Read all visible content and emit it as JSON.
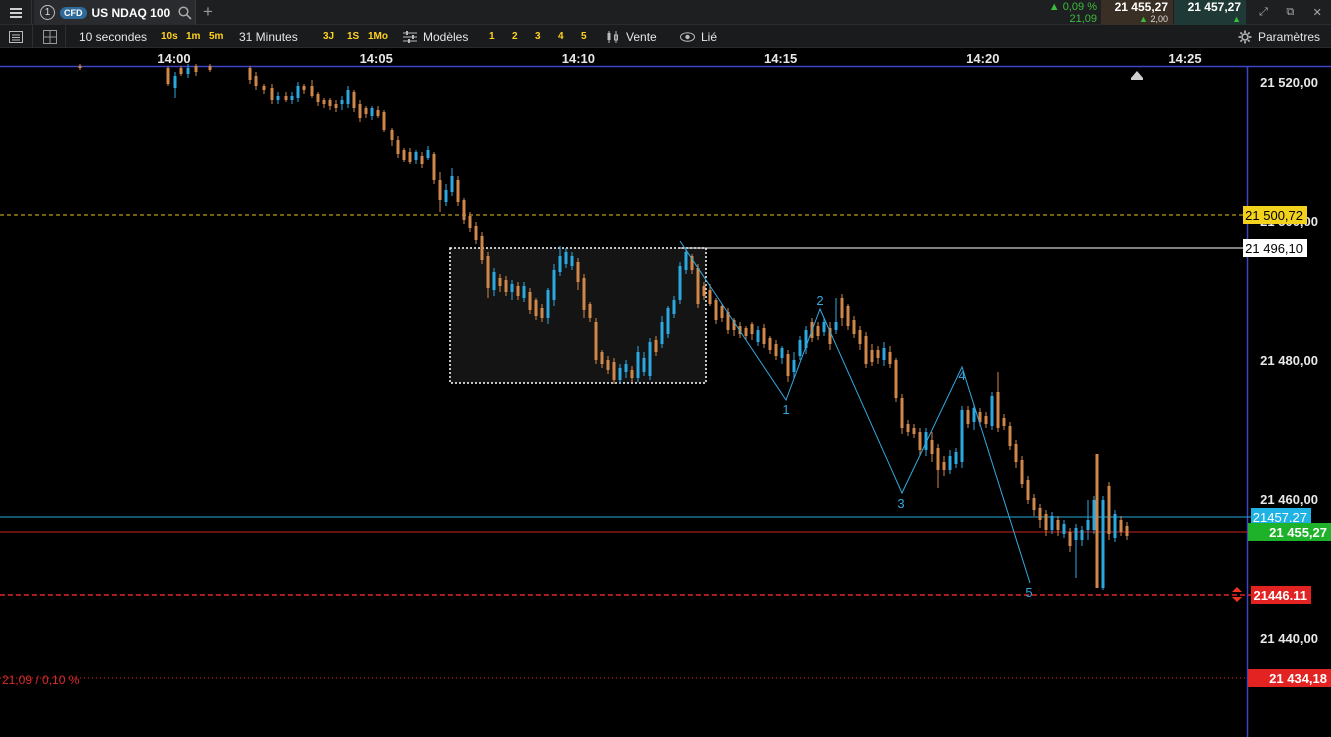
{
  "topbar": {
    "tab_number": "1",
    "cfd_badge": "CFD",
    "instrument": "US NDAQ 100",
    "change_pct": "▲ 0,09 %",
    "change_abs": "21,09",
    "sell_price": "21 455,27",
    "buy_price": "21 457,27",
    "spread": "2,00"
  },
  "toolbar": {
    "interval": "10 secondes",
    "quick_intervals": [
      "10s",
      "1m",
      "5m"
    ],
    "range": "31 Minutes",
    "quick_ranges": [
      "3J",
      "1S",
      "1Mo"
    ],
    "models_label": "Modèles",
    "layouts": [
      "1",
      "2",
      "3",
      "4",
      "5"
    ],
    "sell_label": "Vente",
    "linked_label": "Lié",
    "settings_label": "Paramètres"
  },
  "chart_data": {
    "type": "candlestick",
    "instrument": "US NDAQ 100",
    "x_ticks": [
      "14:00",
      "14:05",
      "14:10",
      "14:15",
      "14:20",
      "14:25"
    ],
    "y_ticks": [
      "21 520,00",
      "21 500,00",
      "21 480,00",
      "21 460,00",
      "21 440,00"
    ],
    "ylim": [
      21426,
      21522
    ],
    "levels": [
      {
        "label": "21 500,72",
        "value": 21500.72,
        "style": "dashed-yellow"
      },
      {
        "label": "21 496,10",
        "value": 21496.1,
        "style": "solid-white"
      },
      {
        "label": "21457.27",
        "value": 21457.27,
        "style": "solid-cyan"
      },
      {
        "label": "21 455,27",
        "value": 21455.27,
        "style": "solid-red-green"
      },
      {
        "label": "21446.11",
        "value": 21446.11,
        "style": "dashed-red"
      },
      {
        "label": "21 434,18",
        "value": 21434.18,
        "style": "dotted-red"
      }
    ],
    "bottom_left_label": "21,09 / 0,10 %",
    "wave_labels": [
      "1",
      "2",
      "3",
      "4",
      "5"
    ],
    "colors": {
      "up": "#2ba8e0",
      "down": "#d0884a",
      "wave": "#34a8e0"
    }
  }
}
